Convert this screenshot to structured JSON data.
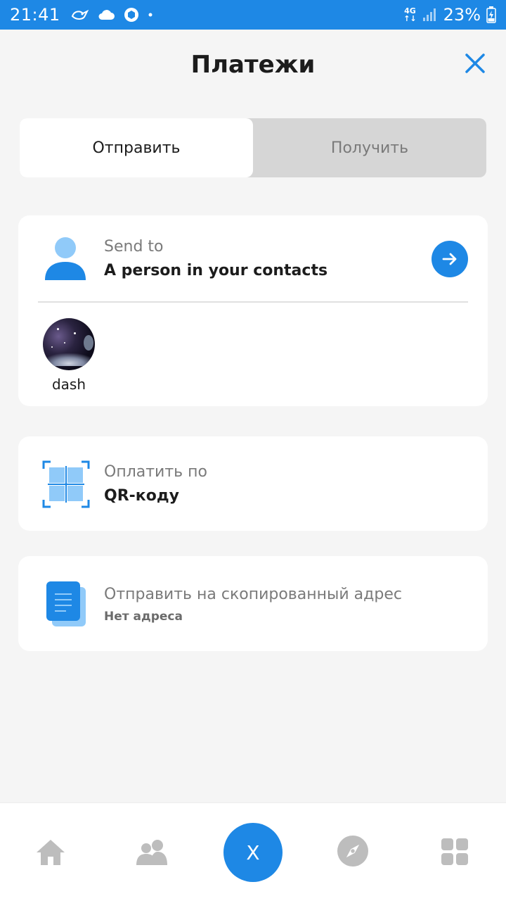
{
  "status_bar": {
    "time": "21:41",
    "network_top": "4G",
    "network_bottom": "↑↓",
    "battery_percent": "23%"
  },
  "header": {
    "title": "Платежи"
  },
  "tabs": [
    {
      "label": "Отправить",
      "active": true
    },
    {
      "label": "Получить",
      "active": false
    }
  ],
  "send_card": {
    "subtitle": "Send to",
    "title": "A person in your contacts",
    "contacts": [
      {
        "name": "dash"
      }
    ]
  },
  "qr_card": {
    "subtitle": "Оплатить по",
    "title": "QR-коду"
  },
  "copy_card": {
    "subtitle": "Отправить на скопированный адрес",
    "detail": "Нет адреса"
  },
  "bottom_nav": {
    "center_label": "X",
    "items": [
      "home-icon",
      "people-icon",
      "x-button",
      "compass-icon",
      "apps-grid-icon"
    ]
  },
  "colors": {
    "accent": "#1e88e5",
    "background": "#f5f5f5",
    "icon_light_blue": "#90caf9",
    "nav_icon_gray": "#bdbdbd"
  }
}
